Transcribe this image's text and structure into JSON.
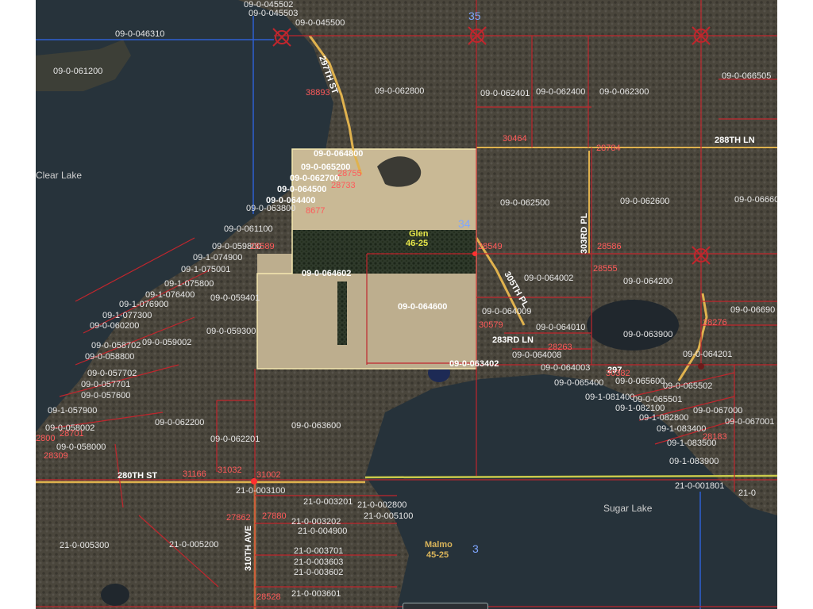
{
  "map": {
    "lakes": {
      "clear": "Clear Lake",
      "sugar": "Sugar Lake"
    },
    "townships": {
      "glen_name": "Glen",
      "glen_code": "46-25",
      "malmo_name": "Malmo",
      "malmo_code": "45-25"
    },
    "sections": {
      "s34": "34",
      "s3": "3",
      "s35": "35"
    },
    "roads": {
      "r297": "297TH ST",
      "r288": "288TH LN",
      "r303": "303RD PL",
      "r305": "305TH PL",
      "r283": "283RD LN",
      "r280": "280TH ST",
      "r310": "310TH AVE",
      "r297b": "297"
    },
    "parcels": {
      "p045502": "09-0-045502",
      "p045503": "09-0-045503",
      "p045500": "09-0-045500",
      "p046310": "09-0-046310",
      "p061200": "09-0-061200",
      "p062800": "09-0-062800",
      "p062401": "09-0-062401",
      "p062400": "09-0-062400",
      "p062300": "09-0-062300",
      "p066505": "09-0-066505",
      "p066600": "09-0-06660",
      "p062500": "09-0-062500",
      "p062600": "09-0-062600",
      "p064800": "09-0-064800",
      "p065200": "09-0-065200",
      "p062700": "09-0-062700",
      "p064500": "09-0-064500",
      "p064400": "09-0-064400",
      "p063800": "09-0-063800",
      "p061100": "09-0-061100",
      "p059800": "09-0-059800",
      "p074900": "09-1-074900",
      "p075001": "09-1-075001",
      "p075800": "09-1-075800",
      "p076400": "09-1-076400",
      "p076900": "09-1-076900",
      "p077300": "09-1-077300",
      "p060200": "09-0-060200",
      "p058702": "09-0-058702",
      "p059002": "09-0-059002",
      "p058800": "09-0-058800",
      "p057702": "09-0-057702",
      "p057701": "09-0-057701",
      "p057600": "09-0-057600",
      "p057900": "09-1-057900",
      "p058002": "09-0-058002",
      "p058000": "09-0-058000",
      "p059401": "09-0-059401",
      "p059300": "09-0-059300",
      "p064602": "09-0-064602",
      "p064600": "09-0-064600",
      "p064002": "09-0-064002",
      "p064200": "09-0-064200",
      "p066900": "09-0-06690",
      "p064009": "09-0-064009",
      "p064010": "09-0-064010",
      "p063900": "09-0-063900",
      "p064201": "09-0-064201",
      "p064008": "09-0-064008",
      "p064003": "09-0-064003",
      "p063402": "09-0-063402",
      "p065400": "09-0-065400",
      "p065600": "09-0-065600",
      "p065502": "09-0-065502",
      "p081400": "09-1-081400",
      "p065501": "09-0-065501",
      "p082100": "09-1-082100",
      "p067000": "09-0-067000",
      "p082800": "09-1-082800",
      "p067001": "09-0-067001",
      "p083400": "09-1-083400",
      "p083500": "09-1-083500",
      "p083900": "09-1-083900",
      "p062200": "09-0-062200",
      "p062201": "09-0-062201",
      "p063600": "09-0-063600",
      "p003100": "21-0-003100",
      "p003201": "21-0-003201",
      "p002800": "21-0-002800",
      "p005100": "21-0-005100",
      "p003202": "21-0-003202",
      "p004900": "21-0-004900",
      "p005300": "21-0-005300",
      "p005200": "21-0-005200",
      "p003701": "21-0-003701",
      "p003603": "21-0-003603",
      "p003602": "21-0-003602",
      "p003601": "21-0-003601",
      "p001801": "21-0-001801",
      "p00c": "21-0"
    },
    "addresses": {
      "a38893": "38893",
      "a30464": "30464",
      "a28784": "28784",
      "a28755": "28755",
      "a28733": "28733",
      "a28677": "8677",
      "a28549": "28549",
      "a28586": "28586",
      "a28555": "28555",
      "a28589": "28589",
      "a28276": "28276",
      "a30579": "30579",
      "a28263": "28263",
      "a30382": "30382",
      "a28309": "28309",
      "a31166": "31166",
      "a31032": "31032",
      "a31002": "31002",
      "a27862": "27862",
      "a27880": "27880",
      "a28528": "28528",
      "a28701": "28701",
      "a28183": "28183",
      "a2800": "2800"
    }
  }
}
